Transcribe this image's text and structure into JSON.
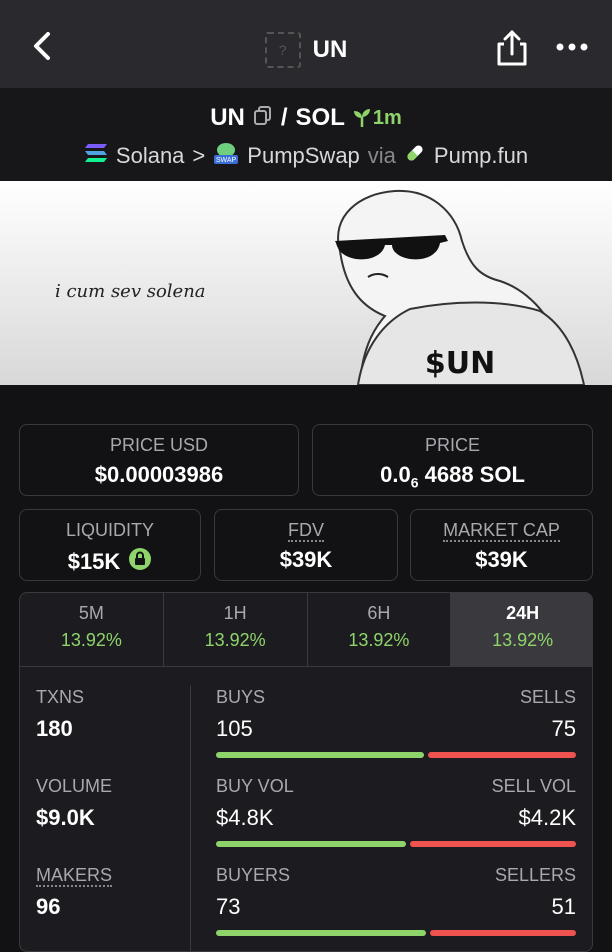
{
  "header": {
    "title": "UN",
    "token_placeholder": "?",
    "icons": {
      "back": "chevron-left-icon",
      "share": "share-icon",
      "more": "more-dots-icon"
    }
  },
  "pair": {
    "base": "UN",
    "separator": "/",
    "quote": "SOL",
    "age": "1m",
    "chain": "Solana",
    "chevron": ">",
    "dex": "PumpSwap",
    "via": "via",
    "launchpad": "Pump.fun"
  },
  "banner": {
    "caption": "i cum sev solena",
    "shirt_text": "$UN"
  },
  "price": {
    "usd_label": "PRICE USD",
    "usd_value": "$0.00003986",
    "native_label": "PRICE",
    "native_prefix": "0.0",
    "native_zeros": "6",
    "native_digits": "4688 SOL"
  },
  "metrics": {
    "liquidity_label": "LIQUIDITY",
    "liquidity_value": "$15K",
    "fdv_label": "FDV",
    "fdv_value": "$39K",
    "mcap_label": "MARKET CAP",
    "mcap_value": "$39K"
  },
  "tabs": [
    {
      "label": "5M",
      "change": "13.92%"
    },
    {
      "label": "1H",
      "change": "13.92%"
    },
    {
      "label": "6H",
      "change": "13.92%"
    },
    {
      "label": "24H",
      "change": "13.92%"
    }
  ],
  "active_tab": "24H",
  "stats": {
    "txns_label": "TXNS",
    "txns_value": "180",
    "buys_label": "BUYS",
    "buys_value": "105",
    "sells_label": "SELLS",
    "sells_value": "75",
    "volume_label": "VOLUME",
    "volume_value": "$9.0K",
    "buy_vol_label": "BUY VOL",
    "buy_vol_value": "$4.8K",
    "sell_vol_label": "SELL VOL",
    "sell_vol_value": "$4.2K",
    "makers_label": "MAKERS",
    "makers_value": "96",
    "buyers_label": "BUYERS",
    "buyers_value": "73",
    "sellers_label": "SELLERS",
    "sellers_value": "51"
  },
  "colors": {
    "positive": "#8fd46b",
    "negative": "#ef5350",
    "background": "#121214"
  }
}
